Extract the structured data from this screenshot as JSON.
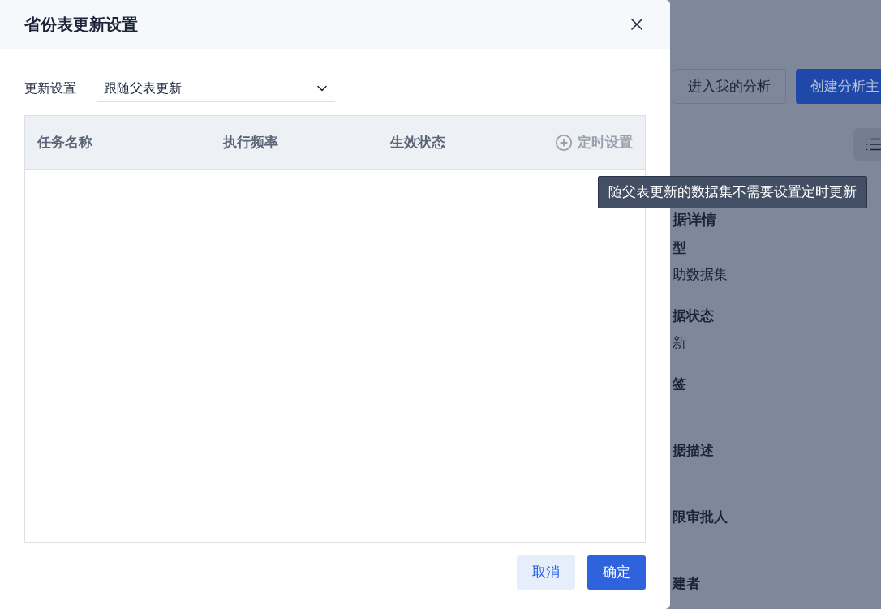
{
  "dialog": {
    "title": "省份表更新设置",
    "update_setting": {
      "label": "更新设置",
      "value": "跟随父表更新"
    },
    "table": {
      "columns": [
        "任务名称",
        "执行频率",
        "生效状态"
      ],
      "action": {
        "label": "定时设置",
        "disabled": true
      }
    },
    "buttons": [
      {
        "label": "取消",
        "kind": "secondary"
      },
      {
        "label": "确定",
        "kind": "primary"
      }
    ]
  },
  "tooltip": {
    "text": "随父表更新的数据集不需要设置定时更新"
  },
  "background": {
    "buttons": [
      {
        "label": "进入我的分析",
        "kind": "secondary"
      },
      {
        "label": "创建分析主",
        "kind": "primary"
      }
    ],
    "details": [
      {
        "kind": "heading",
        "text": "据详情"
      },
      {
        "kind": "label",
        "text": "型"
      },
      {
        "kind": "value",
        "text": "助数据集"
      },
      {
        "kind": "label",
        "text": "据状态"
      },
      {
        "kind": "value",
        "text": "新"
      },
      {
        "kind": "label",
        "text": "签"
      },
      {
        "kind": "label",
        "text": "据描述"
      },
      {
        "kind": "label",
        "text": "限审批人"
      },
      {
        "kind": "label",
        "text": "建者"
      }
    ]
  }
}
